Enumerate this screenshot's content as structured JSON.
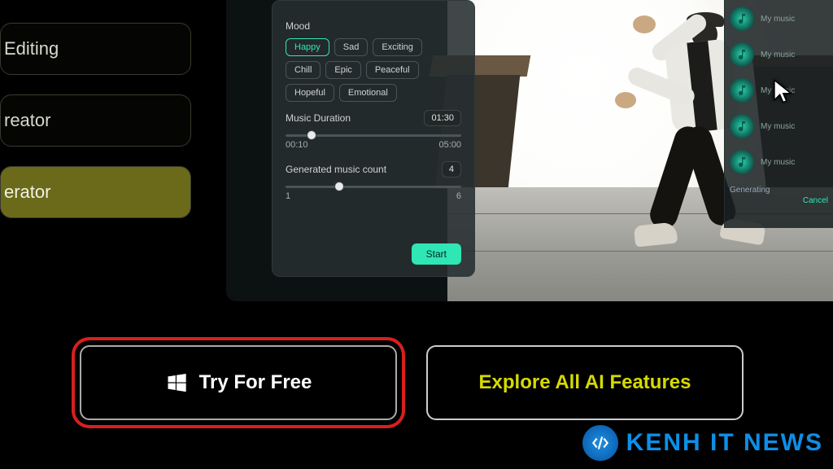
{
  "sidebar": {
    "items": [
      {
        "label": "Editing"
      },
      {
        "label": "reator"
      },
      {
        "label": "erator"
      }
    ],
    "active_index": 2
  },
  "panel": {
    "mood_label": "Mood",
    "moods": [
      "Happy",
      "Sad",
      "Exciting",
      "Chill",
      "Epic",
      "Peaceful",
      "Hopeful",
      "Emotional"
    ],
    "mood_selected": "Happy",
    "duration_label": "Music Duration",
    "duration_min": "00:10",
    "duration_max": "05:00",
    "duration_value": "01:30",
    "duration_thumb_pct": 12,
    "count_label": "Generated music count",
    "count_min": "1",
    "count_max": "6",
    "count_value": "4",
    "count_thumb_pct": 28,
    "start_label": "Start"
  },
  "music": {
    "item_label": "My music",
    "generating": "Generating",
    "cancel": "Cancel"
  },
  "cta": {
    "primary": "Try For Free",
    "secondary": "Explore All AI Features"
  },
  "watermark": {
    "text": "KENH IT NEWS"
  }
}
